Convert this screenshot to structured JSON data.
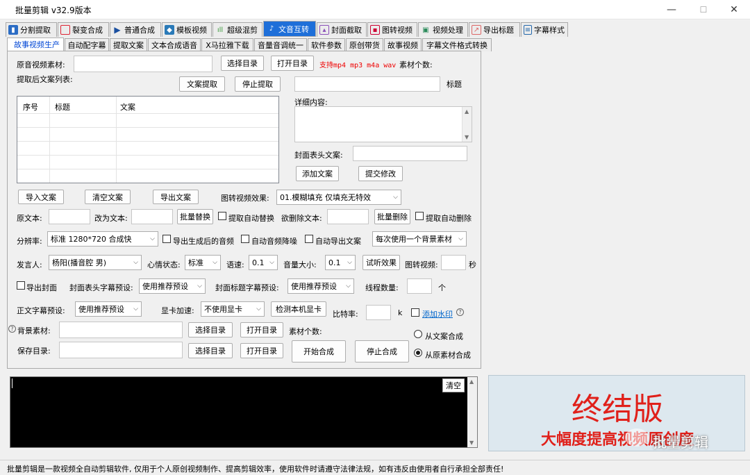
{
  "window": {
    "title": "批量剪辑  v32.9版本",
    "minimize": "—",
    "maximize": "☐",
    "close": "✕"
  },
  "main_tabs": [
    {
      "label": "分割提取",
      "icon": "split-icon",
      "color": "#2b6cc4"
    },
    {
      "label": "裂变合成",
      "icon": "fission-icon",
      "color": "#d23"
    },
    {
      "label": "普通合成",
      "icon": "play-icon",
      "color": "#1a4fa0"
    },
    {
      "label": "模板视频",
      "icon": "template-icon",
      "color": "#2a7ab8"
    },
    {
      "label": "超级混剪",
      "icon": "audio-wave-icon",
      "color": "#3a9a3a"
    },
    {
      "label": "文音互转",
      "icon": "text-audio-icon",
      "color": "#2266cc"
    },
    {
      "label": "封面截取",
      "icon": "image-icon",
      "color": "#8a4fb8"
    },
    {
      "label": "图转视频",
      "icon": "picture-icon",
      "color": "#c03"
    },
    {
      "label": "视频处理",
      "icon": "video-process-icon",
      "color": "#2a8a5a"
    },
    {
      "label": "导出标题",
      "icon": "export-icon",
      "color": "#d66"
    },
    {
      "label": "字幕样式",
      "icon": "subtitle-icon",
      "color": "#2266aa"
    }
  ],
  "sub_tabs": [
    "故事视频生产",
    "自动配字幕",
    "提取文案",
    "文本合成语音",
    "X马拉雅下载",
    "音量音调统一",
    "软件参数",
    "原创带货",
    "故事视频",
    "字幕文件格式转换"
  ],
  "form": {
    "source_label": "原音视频素材:",
    "select_dir": "选择目录",
    "open_dir": "打开目录",
    "support_text": "支持mp4 mp3 m4a wav",
    "material_count": "素材个数:",
    "extracted_list": "提取后文案列表:",
    "extract_btn": "文案提取",
    "stop_extract_btn": "停止提取",
    "title_label": "标题",
    "detail_label": "详细内容:",
    "cover_head_label": "封面表头文案:",
    "add_copy_btn": "添加文案",
    "submit_btn": "提交修改",
    "grid_headers": [
      "序号",
      "标题",
      "文案"
    ],
    "import_btn": "导入文案",
    "clear_copy_btn": "清空文案",
    "export_btn": "导出文案",
    "img_effect_label": "图转视频效果:",
    "img_effect_value": "01.模糊填充 仅填充无特效",
    "orig_text_label": "原文本:",
    "change_to_label": "改为文本:",
    "batch_replace_btn": "批量替换",
    "auto_replace": "提取自动替换",
    "delete_text_label": "欲删除文本:",
    "batch_delete_btn": "批量删除",
    "auto_delete": "提取自动删除",
    "resolution_label": "分辨率:",
    "resolution_value": "标准 1280*720 合成快",
    "export_audio": "导出生成后的音频",
    "auto_denoise": "自动音频降噪",
    "auto_export_copy": "自动导出文案",
    "bg_mode_value": "每次使用一个背景素材",
    "speaker_label": "发言人:",
    "speaker_value": "杨阳(播音腔 男)",
    "mood_label": "心情状态:",
    "mood_value": "标准",
    "speed_label": "语速:",
    "speed_value": "0.1",
    "volume_label": "音量大小:",
    "volume_value": "0.1",
    "listen_btn": "试听效果",
    "img_video_label": "图转视频:",
    "seconds": "秒",
    "export_cover": "导出封面",
    "cover_head_preset_label": "封面表头字幕预设:",
    "cover_head_preset_value": "使用推荐预设",
    "cover_title_preset_label": "封面标题字幕预设:",
    "cover_title_preset_value": "使用推荐预设",
    "threads_label": "线程数量:",
    "threads_unit": "个",
    "body_preset_label": "正文字幕预设:",
    "body_preset_value": "使用推荐预设",
    "gpu_label": "显卡加速:",
    "gpu_value": "不使用显卡",
    "detect_gpu_btn": "检测本机显卡",
    "bitrate_label": "比特率:",
    "bitrate_unit": "k",
    "watermark_label": "添加水印",
    "help_mark": "?",
    "bg_material_label": "背景素材:",
    "bg_count_label": "素材个数:",
    "from_copy": "从文案合成",
    "save_dir_label": "保存目录:",
    "start_btn": "开始合成",
    "stop_btn": "停止合成",
    "from_source": "从原素材合成"
  },
  "console": {
    "clear_btn": "清空"
  },
  "ad": {
    "headline": "终结版",
    "subline": "大幅度提高视频原创度",
    "watermark": "批量剪辑"
  },
  "status_text": "批量剪辑是一款视频全自动剪辑软件, 仅用于个人原创视频制作、提高剪辑效率，使用软件时请遵守法律法规，如有违反由使用者自行承担全部责任!"
}
